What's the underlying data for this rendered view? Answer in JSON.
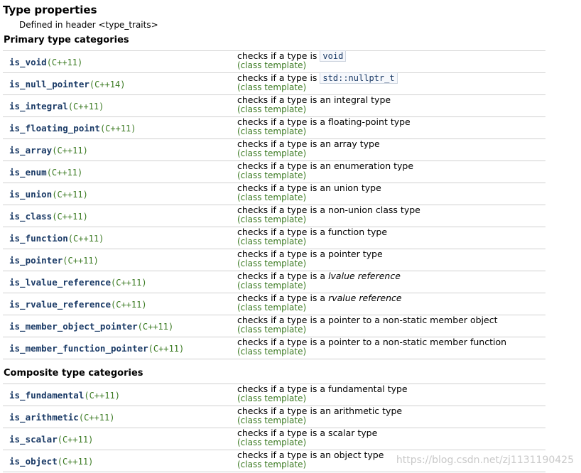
{
  "header": {
    "title": "Type properties",
    "defined_prefix": "Defined in header ",
    "header_name": "<type_traits>"
  },
  "sections": [
    {
      "heading": "Primary type categories",
      "rows": [
        {
          "name": "is_void",
          "version": "(C++11)",
          "desc_pre": "checks if a type is ",
          "desc_code": "void",
          "desc_em": "",
          "desc_post": "",
          "kind": "(class template)"
        },
        {
          "name": "is_null_pointer",
          "version": "(C++14)",
          "desc_pre": "checks if a type is ",
          "desc_code": "std::nullptr_t",
          "desc_em": "",
          "desc_post": "",
          "kind": "(class template)"
        },
        {
          "name": "is_integral",
          "version": "(C++11)",
          "desc_pre": "checks if a type is an integral type",
          "desc_code": "",
          "desc_em": "",
          "desc_post": "",
          "kind": "(class template)"
        },
        {
          "name": "is_floating_point",
          "version": "(C++11)",
          "desc_pre": "checks if a type is a floating-point type",
          "desc_code": "",
          "desc_em": "",
          "desc_post": "",
          "kind": "(class template)"
        },
        {
          "name": "is_array",
          "version": "(C++11)",
          "desc_pre": "checks if a type is an array type",
          "desc_code": "",
          "desc_em": "",
          "desc_post": "",
          "kind": "(class template)"
        },
        {
          "name": "is_enum",
          "version": "(C++11)",
          "desc_pre": "checks if a type is an enumeration type",
          "desc_code": "",
          "desc_em": "",
          "desc_post": "",
          "kind": "(class template)"
        },
        {
          "name": "is_union",
          "version": "(C++11)",
          "desc_pre": "checks if a type is an union type",
          "desc_code": "",
          "desc_em": "",
          "desc_post": "",
          "kind": "(class template)"
        },
        {
          "name": "is_class",
          "version": "(C++11)",
          "desc_pre": "checks if a type is a non-union class type",
          "desc_code": "",
          "desc_em": "",
          "desc_post": "",
          "kind": "(class template)"
        },
        {
          "name": "is_function",
          "version": "(C++11)",
          "desc_pre": "checks if a type is a function type",
          "desc_code": "",
          "desc_em": "",
          "desc_post": "",
          "kind": "(class template)"
        },
        {
          "name": "is_pointer",
          "version": "(C++11)",
          "desc_pre": "checks if a type is a pointer type",
          "desc_code": "",
          "desc_em": "",
          "desc_post": "",
          "kind": "(class template)"
        },
        {
          "name": "is_lvalue_reference",
          "version": "(C++11)",
          "desc_pre": "checks if a type is a ",
          "desc_code": "",
          "desc_em": "lvalue reference",
          "desc_post": "",
          "kind": "(class template)"
        },
        {
          "name": "is_rvalue_reference",
          "version": "(C++11)",
          "desc_pre": "checks if a type is a ",
          "desc_code": "",
          "desc_em": "rvalue reference",
          "desc_post": "",
          "kind": "(class template)"
        },
        {
          "name": "is_member_object_pointer",
          "version": "(C++11)",
          "desc_pre": "checks if a type is a pointer to a non-static member object",
          "desc_code": "",
          "desc_em": "",
          "desc_post": "",
          "kind": "(class template)"
        },
        {
          "name": "is_member_function_pointer",
          "version": "(C++11)",
          "desc_pre": "checks if a type is a pointer to a non-static member function",
          "desc_code": "",
          "desc_em": "",
          "desc_post": "",
          "kind": "(class template)"
        }
      ]
    },
    {
      "heading": "Composite type categories",
      "rows": [
        {
          "name": "is_fundamental",
          "version": "(C++11)",
          "desc_pre": "checks if a type is a fundamental type",
          "desc_code": "",
          "desc_em": "",
          "desc_post": "",
          "kind": "(class template)"
        },
        {
          "name": "is_arithmetic",
          "version": "(C++11)",
          "desc_pre": "checks if a type is an arithmetic type",
          "desc_code": "",
          "desc_em": "",
          "desc_post": "",
          "kind": "(class template)"
        },
        {
          "name": "is_scalar",
          "version": "(C++11)",
          "desc_pre": "checks if a type is a scalar type",
          "desc_code": "",
          "desc_em": "",
          "desc_post": "",
          "kind": "(class template)"
        },
        {
          "name": "is_object",
          "version": "(C++11)",
          "desc_pre": "checks if a type is an object type",
          "desc_code": "",
          "desc_em": "",
          "desc_post": "",
          "kind": "(class template)"
        }
      ]
    }
  ],
  "watermark": "https://blog.csdn.net/zj1131190425"
}
